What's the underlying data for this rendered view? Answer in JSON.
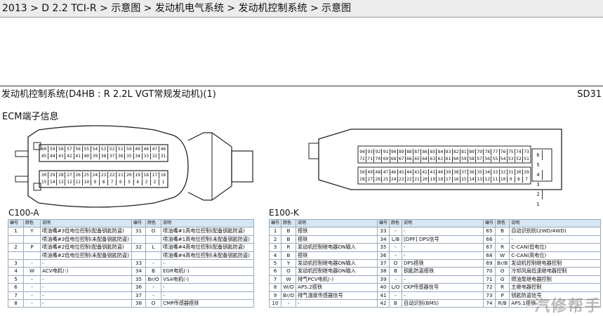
{
  "breadcrumb": "2013 > D 2.2 TCI-R > 示意图 > 发动机电气系统 > 发动机控制系统 > 示意图",
  "page": {
    "title": "发动机控制系统(D4HB : R 2.2L VGT常规发动机)(1)",
    "code": "SD31",
    "subtitle": "ECM端子信息"
  },
  "connector_a": {
    "label": "C100-A",
    "rows": [
      "60|59|58|57|56|55|54|53|52|51|50|49|48|47|46",
      "45|44|43|42|41|40|39|38|37|36|35|34|33|32|31",
      "30|29|28|27|26|25|24|23|22|21|20|19|18|17|16",
      "15|14|13|12|11|10|9|8|7|6|5|4|3|2|1"
    ]
  },
  "connector_k": {
    "label": "E100-K",
    "rows": [
      "94|93|92|91|90|89|88|87|86|85|84|83|82|81|80|79|78|77|76|75|74|73",
      "72|71|70|69|68|67|66|65|64|63|62|61|60|59|58|57|56|55|54|53|52|51",
      "50|49|48|47|46|45|44|43|42|41|40|39|38|37|36|35|34|33|32|31|30|29",
      "28|27|26|25|24|23|22|21|20|19|18|17|16|15|14|13|12|11|10|9|8|7"
    ],
    "side": [
      "6",
      "5",
      "4",
      "3",
      "2",
      "1"
    ]
  },
  "header": {
    "no": "编号",
    "color": "颜色",
    "desc": "说明"
  },
  "table_a": [
    [
      "1",
      "Y",
      "喷油嘴#3低电位控制(配备钥匙防盗)",
      "31",
      "O",
      "喷油嘴#1高电位控制(配备钥匙防盗)"
    ],
    [
      "",
      "",
      "喷油嘴#3低电位控制(未配备钥匙防盗)",
      "",
      "",
      "喷油嘴#1高电位控制(未配备钥匙防盗)"
    ],
    [
      "2",
      "P",
      "喷油嘴#2低电位控制(配备钥匙防盗)",
      "32",
      "L",
      "喷油嘴#4高电位控制(配备钥匙防盗)"
    ],
    [
      "",
      "",
      "喷油嘴#2低电位控制(未配备钥匙防盗)",
      "",
      "",
      "喷油嘴#4高电位控制(未配备钥匙防盗)"
    ],
    [
      "3",
      "-",
      "-",
      "33",
      "-",
      "-"
    ],
    [
      "4",
      "W",
      "ACV电机(-)",
      "34",
      "B",
      "EGR电机(-)"
    ],
    [
      "5",
      "-",
      "-",
      "35",
      "Br/O",
      "VSA电机(-)"
    ],
    [
      "6",
      "-",
      "-",
      "36",
      "-",
      "-"
    ],
    [
      "7",
      "-",
      "-",
      "37",
      "-",
      "-"
    ],
    [
      "8",
      "-",
      "-",
      "38",
      "O",
      "CMP传感器搭铁"
    ]
  ],
  "table_k": [
    [
      "1",
      "B",
      "搭铁",
      "33",
      "-",
      "-",
      "65",
      "B",
      "自动识别别(2WD/4WD)"
    ],
    [
      "2",
      "B",
      "搭铁",
      "34",
      "L/B",
      "[DPF] DPS信号",
      "66",
      "-",
      "-"
    ],
    [
      "3",
      "R",
      "发动机控制继电器ON输入",
      "35",
      "-",
      "-",
      "67",
      "R",
      "C-CAN(低电位)"
    ],
    [
      "4",
      "B",
      "搭铁",
      "36",
      "-",
      "-",
      "68",
      "W",
      "C-CAN(高电位)"
    ],
    [
      "5",
      "Y",
      "发动机控制继电器ON输入",
      "37",
      "O",
      "DPS搭铁",
      "69",
      "Br/B",
      "发动机控制继电器控制"
    ],
    [
      "6",
      "O",
      "发动机控制继电器ON输入",
      "38",
      "B",
      "钥匙防盗搭铁",
      "70",
      "O",
      "冷却风扇低速继电器控制"
    ],
    [
      "7",
      "W",
      "排气PCV电机(-)",
      "39",
      "-",
      "-",
      "71",
      "G",
      "燃油泵继电器控制"
    ],
    [
      "8",
      "W/O",
      "APS.2搭铁",
      "40",
      "L/O",
      "CKP传感器信号",
      "72",
      "R",
      "主继电器控制"
    ],
    [
      "9",
      "Br/O",
      "排气温度传感器信号",
      "41",
      "-",
      "-",
      "73",
      "P",
      "钥匙防盗信号"
    ],
    [
      "10",
      "-",
      "-",
      "42",
      "B",
      "自动识别(BMS)",
      "74",
      "R/B",
      "APS.1搭铁"
    ]
  ],
  "watermark": "汽修帮手"
}
